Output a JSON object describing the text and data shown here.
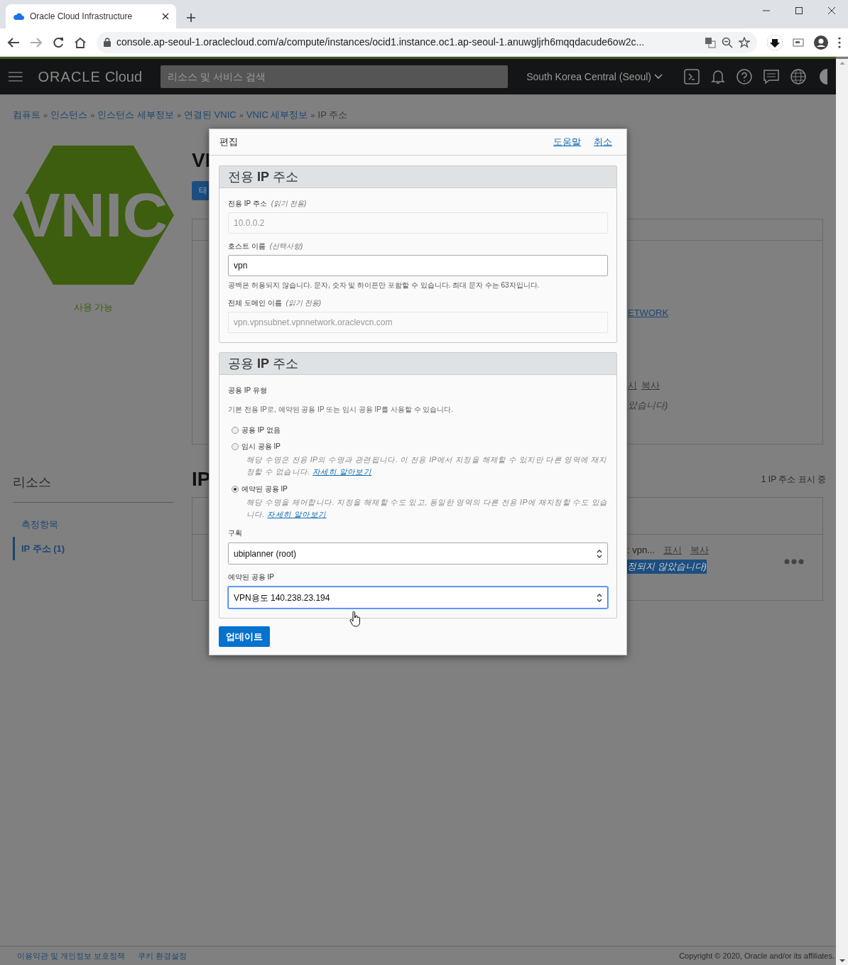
{
  "browser": {
    "tab_title": "Oracle Cloud Infrastructure",
    "url": "console.ap-seoul-1.oraclecloud.com/a/compute/instances/ocid1.instance.oc1.ap-seoul-1.anuwgljrh6mqqdacude6ow2c..."
  },
  "top_nav": {
    "logo": "ORACLE",
    "logo_suffix": "Cloud",
    "search_placeholder": "리소스 및 서비스 검색",
    "region": "South Korea Central (Seoul)"
  },
  "breadcrumbs": [
    "컴퓨트",
    "인스턴스",
    "인스턴스 세부정보",
    "연결된 VNIC",
    "VNIC 세부정보",
    "IP 주소"
  ],
  "breadcrumb_separator": "»",
  "resource": {
    "logo_text": "VNIC",
    "status": "사용 가능",
    "title": "VI",
    "action_button": "태"
  },
  "details_card": {
    "link": "ETWORK",
    "links": [
      "시",
      "복사"
    ],
    "note": "았습니다)"
  },
  "resources_menu": {
    "title": "리소스",
    "items": [
      {
        "label": "측정항목",
        "selected": false
      },
      {
        "label": "IP 주소 (1)",
        "selected": true
      }
    ]
  },
  "ip_section": {
    "title": "IP",
    "count": "1 IP 주소 표시 중",
    "row": {
      "value": ": vpn...",
      "links": [
        "표시",
        "복사"
      ],
      "note": "정되지 않았습니다)"
    }
  },
  "dialog": {
    "title": "편집",
    "links": [
      "도움말",
      "취소"
    ],
    "sections": [
      {
        "title": "전용 **IP** 주소",
        "fields": [
          {
            "kind": "text",
            "label": "전용 IP 주소",
            "hint": "(읽기 전용)",
            "value": "10.0.0.2",
            "disabled": true
          },
          {
            "kind": "text",
            "label": "호스트 이름",
            "hint": "(선택사항)",
            "value": "vpn",
            "disabled": false,
            "help": "공백은 허용되지 않습니다. 문자, 숫자 및 하이픈만 포함할 수 있습니다. 최대 문자 수는 63자입니다."
          },
          {
            "kind": "text",
            "label": "전체 도메인 이름",
            "hint": "(읽기 전용)",
            "value": "vpn.vpnsubnet.vpnnetwork.oraclevcn.com",
            "disabled": true
          }
        ]
      },
      {
        "title": "공용 **IP** 주소",
        "fields": [
          {
            "kind": "radio_group",
            "label": "공용 IP 유형",
            "help": "기본 전용 IP로, 예약된 공용 IP 또는 임시 공용 IP를 사용할 수 있습니다.",
            "options": [
              {
                "label": "공용 IP 없음",
                "selected": false
              },
              {
                "label": "임시 공용 IP",
                "selected": false,
                "description": "해당 수명은 전용 IP의 수명과 관련됩니다. 이 전용 IP에서 지정을 해제할 수 있지만 다른 영역에 재지정할 수 없습니다.",
                "link": "자세히 알아보기"
              },
              {
                "label": "예약된 공용 IP",
                "selected": true,
                "description": "해당 수명을 제어합니다. 지정을 해제할 수도 있고, 동일한 영역의 다른 전용 IP에 재지정할 수도 있습니다.",
                "link": "자세히 알아보기"
              }
            ]
          },
          {
            "kind": "select",
            "label": "구획",
            "value": "ubiplanner (root)",
            "focused": false
          },
          {
            "kind": "select",
            "label": "예약된 공용 IP",
            "value": "VPN용도 140.238.23.194",
            "focused": true
          }
        ]
      }
    ],
    "submit": "업데이트"
  },
  "footer": {
    "links": [
      "이용약관 및 개인정보 보호정책",
      "쿠키 환경설정"
    ],
    "copyright": "Copyright © 2020, Oracle and/or its affiliates."
  }
}
